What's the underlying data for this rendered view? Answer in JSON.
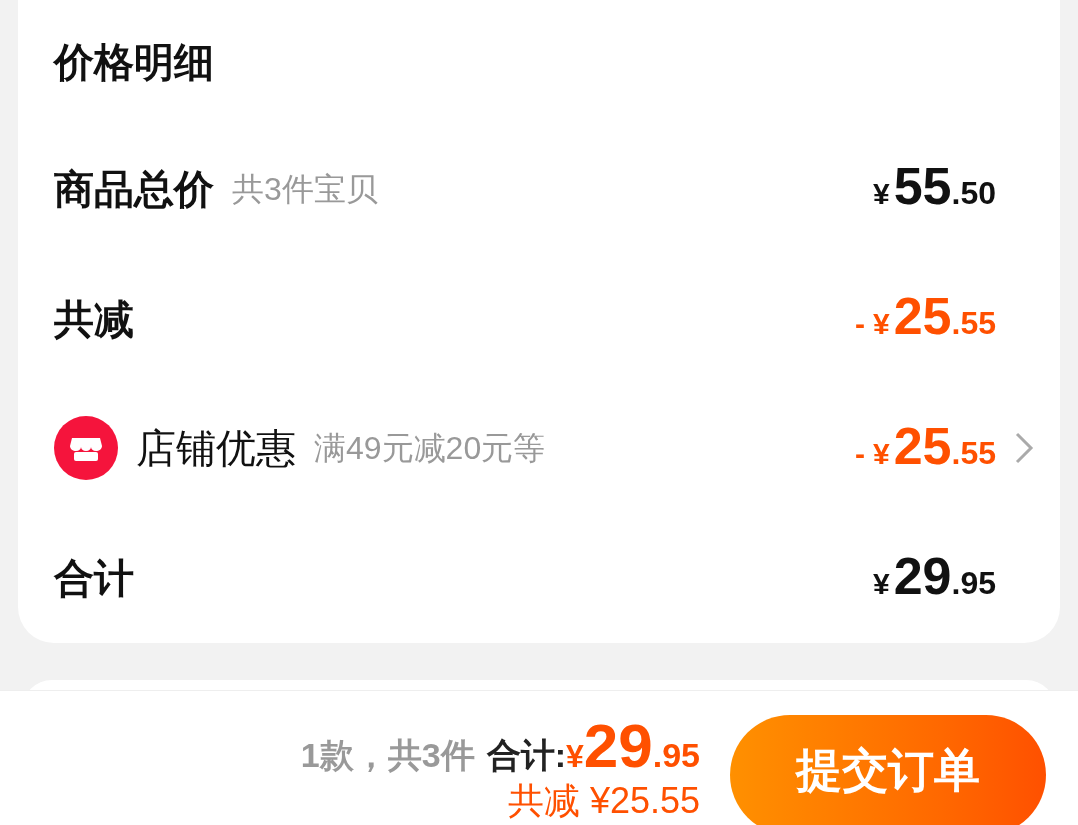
{
  "card": {
    "title": "价格明细",
    "rows": [
      {
        "kind": "plain",
        "label": "商品总价",
        "note": "共3件宝贝",
        "price": {
          "color": "#111111",
          "currency": "¥",
          "integer": "55",
          "decimal": ".50"
        },
        "chevron": false
      },
      {
        "kind": "plain",
        "label": "共减",
        "price": {
          "color": "#ff5000",
          "sign": "-",
          "currency": "¥",
          "integer": "25",
          "decimal": ".55"
        },
        "chevron": false
      },
      {
        "kind": "shop",
        "label": "店铺优惠",
        "note": "满49元减20元等",
        "price": {
          "color": "#ff5000",
          "sign": "-",
          "currency": "¥",
          "integer": "25",
          "decimal": ".55"
        },
        "chevron": true
      },
      {
        "kind": "plain",
        "label": "合计",
        "price": {
          "color": "#111111",
          "currency": "¥",
          "integer": "29",
          "decimal": ".95"
        },
        "chevron": false
      }
    ]
  },
  "footer": {
    "count": "1款，共3件",
    "total_label": "合计:",
    "total": {
      "currency": "¥",
      "integer": "29",
      "decimal": ".95"
    },
    "saved": "共减 ¥25.55",
    "submit": "提交订单"
  }
}
